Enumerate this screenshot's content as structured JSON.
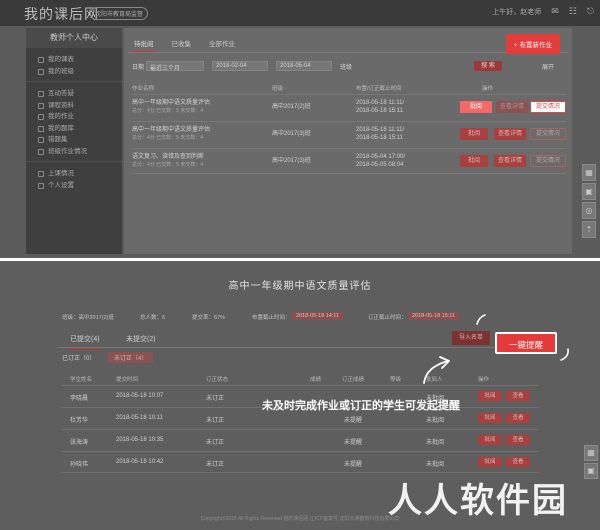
{
  "app": {
    "brand": "我的课后网",
    "badge": "沈阳市教育局监督"
  },
  "topbar": {
    "greeting": "上午好，赵老师"
  },
  "sidebar": {
    "title": "教师个人中心",
    "groups": [
      [
        {
          "label": "我的课表",
          "icon": "calendar-icon"
        },
        {
          "label": "我的班级",
          "icon": "class-icon"
        }
      ],
      [
        {
          "label": "互动答疑",
          "icon": "chat-icon"
        },
        {
          "label": "课程资料",
          "icon": "folder-icon"
        },
        {
          "label": "我的作业",
          "icon": "homework-icon"
        },
        {
          "label": "我的题库",
          "icon": "question-bank-icon"
        },
        {
          "label": "错题集",
          "icon": "mistake-icon"
        },
        {
          "label": "班级作业情况",
          "icon": "chart-icon"
        }
      ],
      [
        {
          "label": "上课情况",
          "icon": "attendance-icon"
        },
        {
          "label": "个人设置",
          "icon": "user-icon"
        }
      ]
    ]
  },
  "main": {
    "tabs": [
      "待批阅",
      "已收集",
      "全部作业"
    ],
    "new_button": "+ 布置新作业",
    "filter": {
      "label": "日期",
      "range": "最近三个月",
      "start": "2018-02-04",
      "end": "2018-05-04",
      "class_label": "班级",
      "search": "搜 索",
      "more": "展开"
    },
    "columns": [
      "作业名称",
      "班级",
      "布置/订正截止时间",
      "操作"
    ],
    "rows": [
      {
        "name": "高中一年级期中语文质量评估",
        "meta": "总分：4分    已交数：5    未交数：4",
        "class": "高中2017(2)班",
        "time1": "2018-05-18 11:11/",
        "time2": "2018-05-18 15:11",
        "b1": "批阅",
        "b2": "查看详情",
        "b3": "提交情况"
      },
      {
        "name": "高中一年级期中语文质量评估",
        "meta": "总分：4分    已交数：5    未交数：4",
        "class": "高中2017(3)班",
        "time1": "2018-05-18 11:11/",
        "time2": "2018-05-18 15:11",
        "b1": "批阅",
        "b2": "查看详情",
        "b3": "提交情况"
      },
      {
        "name": "语文复习、读错及查到判断",
        "meta": "总分：4分    已交数：5    未交数：4",
        "class": "高中2017(3)班",
        "time1": "2018-05-04 17:00/",
        "time2": "2018-05-05 08:04",
        "b1": "批阅",
        "b2": "查看详情",
        "b3": "提交情况"
      }
    ]
  },
  "detail": {
    "title": "高中一年级期中语文质量评估",
    "info": {
      "class": "班级：高中2017(2)班",
      "count": "总人数：6",
      "rate": "提交率：67%",
      "deadline_label": "布置截止时间：",
      "deadline": "2018-05-18 14:11",
      "fix_label": "订正截止时间：",
      "fix": "2018-05-18 15:11"
    },
    "tabs": [
      "已提交(4)",
      "未提交(2)"
    ],
    "import_button": "导入名单",
    "remind_button": "一键提醒",
    "sub_tabs": [
      "已订正（0）",
      "未订正（4）"
    ],
    "columns": [
      "学生姓名",
      "提交时间",
      "订正状态",
      "成绩",
      "订正成绩",
      "等级",
      "批阅人",
      "操作"
    ],
    "rows": [
      {
        "name": "李晓晨",
        "time": "2018-05-18 10:07",
        "status": "未订正",
        "note": "",
        "reviewer": "未批阅",
        "b1": "批阅",
        "b2": "查看"
      },
      {
        "name": "杜芳华",
        "time": "2018-05-18 10:11",
        "status": "未订正",
        "note": "未提醒",
        "reviewer": "未批阅",
        "b1": "批阅",
        "b2": "查看"
      },
      {
        "name": "张海涛",
        "time": "2018-05-18 10:35",
        "status": "未订正",
        "note": "未提醒",
        "reviewer": "未批阅",
        "b1": "批阅",
        "b2": "查看"
      },
      {
        "name": "孙晓伟",
        "time": "2018-05-18 10:42",
        "status": "未订正",
        "note": "未提醒",
        "reviewer": "未批阅",
        "b1": "批阅",
        "b2": "查看"
      }
    ],
    "callout": "未及时完成作业或订正的学生可发起提醒",
    "copyright": "Copyright©2018 All Rights Reserved 我的课后网 辽ICP备案号 沈阳云课教育科技有限公司"
  },
  "watermark": "人人软件园",
  "colors": {
    "accent": "#e43a3a",
    "overlay": "#5e5e5e"
  }
}
